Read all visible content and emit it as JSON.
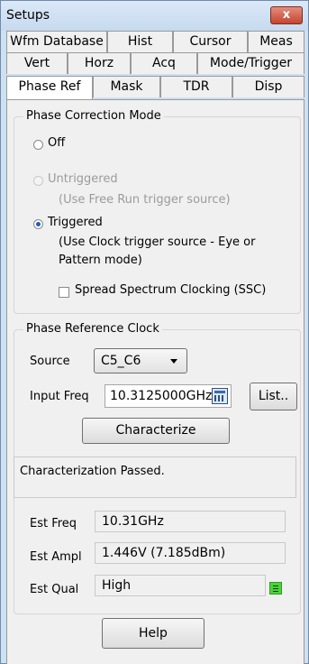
{
  "window": {
    "title": "Setups",
    "close_label": "x"
  },
  "tabs": {
    "row1": [
      "Wfm Database",
      "Hist",
      "Cursor",
      "Meas"
    ],
    "row2": [
      "Vert",
      "Horz",
      "Acq",
      "Mode/Trigger"
    ],
    "row3": [
      "Phase Ref",
      "Mask",
      "TDR",
      "Disp"
    ],
    "active": "Phase Ref"
  },
  "phase_correction": {
    "legend": "Phase Correction Mode",
    "off_label": "Off",
    "untriggered_label": "Untriggered",
    "untriggered_note": "(Use Free Run trigger source)",
    "triggered_label": "Triggered",
    "triggered_note_line1": "(Use Clock trigger source - Eye or",
    "triggered_note_line2": "Pattern mode)",
    "ssc_label": "Spread Spectrum Clocking (SSC)",
    "selected": "Triggered"
  },
  "reference_clock": {
    "legend": "Phase Reference Clock",
    "source_label": "Source",
    "source_value": "C5_C6",
    "input_freq_label": "Input Freq",
    "input_freq_value": "10.3125000GHz",
    "list_button": "List..",
    "characterize_button": "Characterize",
    "status": "Characterization Passed.",
    "est_freq_label": "Est Freq",
    "est_freq_value": "10.31GHz",
    "est_ampl_label": "Est Ampl",
    "est_ampl_value": "1.446V (7.185dBm)",
    "est_qual_label": "Est Qual",
    "est_qual_value": "High",
    "quality_color": "#4bd23b"
  },
  "help_button": "Help"
}
